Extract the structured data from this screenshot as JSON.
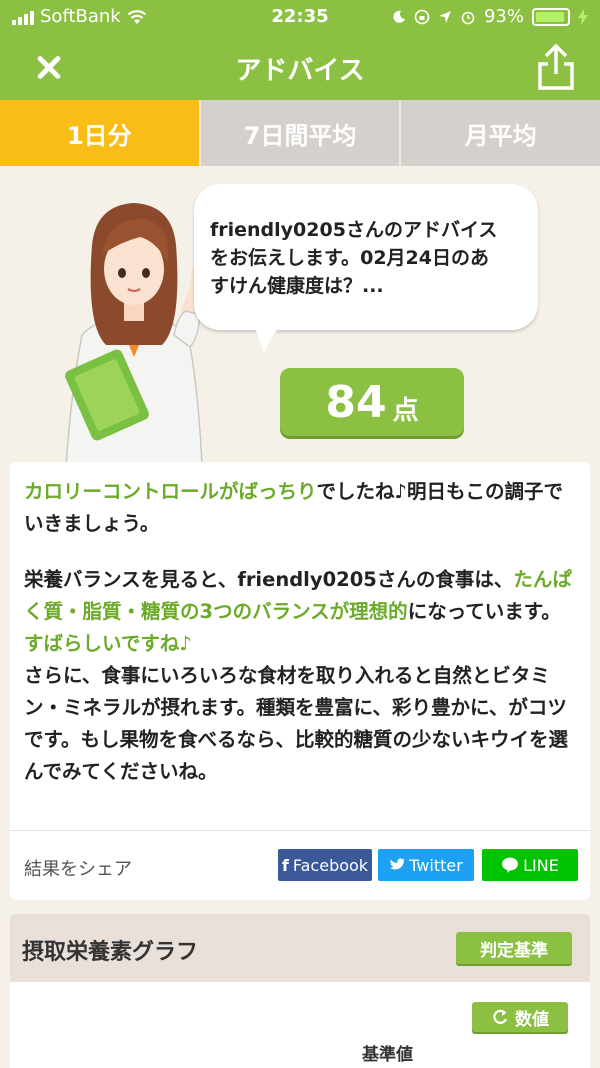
{
  "status_bar": {
    "carrier": "SoftBank",
    "time": "22:35",
    "battery": "93%",
    "battery_level": 0.93
  },
  "header": {
    "title": "アドバイス",
    "close_icon": "close-icon",
    "share_icon": "share-icon"
  },
  "tabs": [
    {
      "label": "1日分",
      "active": true
    },
    {
      "label": "7日間平均",
      "active": false
    },
    {
      "label": "月平均",
      "active": false
    }
  ],
  "advice": {
    "bubble_line1": "friendly0205さんのアドバイス",
    "bubble_line2": "をお伝えします。02月24日のあ",
    "bubble_line3": "すけん健康度は？...",
    "score": "84",
    "score_unit": "点"
  },
  "message": {
    "p1_highlight": "カロリーコントロールがばっちり",
    "p1_rest": "でしたね♪明日もこの調子でいきましょう。",
    "p2_intro": "栄養バランスを見ると、friendly0205さんの食事は、",
    "p2_highlight": "たんぱく質・脂質・糖質の3つのバランスが理想的",
    "p2_mid": "になっています。",
    "p2_highlight2": "すばらしいですね♪",
    "p3": "さらに、食事にいろいろな食材を取り入れると自然とビタミン・ミネラルが摂れます。種類を豊富に、彩り豊かに、がコツです。もし果物を食べるなら、比較的糖質の少ないキウイを選んでみてくださいね。"
  },
  "share": {
    "label": "結果をシェア",
    "facebook": "Facebook",
    "twitter": "Twitter",
    "line": "LINE"
  },
  "graph": {
    "title": "摂取栄養素グラフ",
    "judge_button": "判定基準",
    "number_button": "数値",
    "base_label": "基準値"
  },
  "colors": {
    "brand_green": "#8cc043",
    "active_tab": "#f9bd17",
    "highlight_text": "#6caa2a"
  }
}
